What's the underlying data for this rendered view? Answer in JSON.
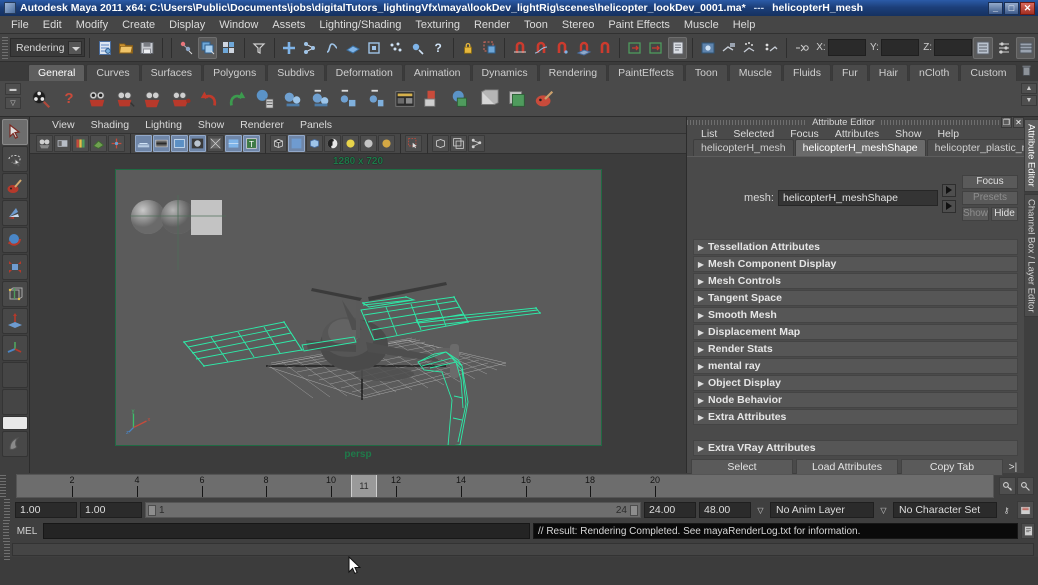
{
  "window": {
    "title": "Autodesk Maya 2011 x64: C:\\Users\\Public\\Documents\\jobs\\digitalTutors_lightingVfx\\maya\\lookDev_lightRig\\scenes\\helicopter_lookDev_0001.ma*",
    "separator": "---",
    "selected_object": "helicopterH_mesh",
    "minimize": "_",
    "restore": "□",
    "close": "✕"
  },
  "menubar": {
    "items": [
      "File",
      "Edit",
      "Modify",
      "Create",
      "Display",
      "Window",
      "Assets",
      "Lighting/Shading",
      "Texturing",
      "Render",
      "Toon",
      "Stereo",
      "Paint Effects",
      "Muscle",
      "Help"
    ]
  },
  "statusline": {
    "mode": "Rendering",
    "icons": [
      "new-scene-icon",
      "open-scene-icon",
      "save-scene-icon",
      "select-by-hierarchy-icon",
      "select-by-object-icon",
      "select-by-component-icon",
      "selection-mask-icon",
      "select-all-icon",
      "select-hierarchy-icon",
      "select-curve-icon",
      "select-surface-icon",
      "select-deformation-icon",
      "select-dynamic-icon",
      "select-rendering-icon",
      "select-other-icon",
      "lock-icon",
      "highlight-selection-icon",
      "snap-grid-icon",
      "snap-curve-icon",
      "snap-point-icon",
      "snap-view-plane-icon",
      "snap-live-icon",
      "construction-history-in-icon",
      "construction-history-out-icon",
      "render-settings-icon",
      "render-current-frame-icon",
      "ipr-render-icon",
      "render-sequence-icon",
      "render-view-icon",
      "input-output-icon"
    ],
    "coord_labels": [
      "X:",
      "Y:",
      "Z:"
    ],
    "coord_values": [
      "",
      "",
      ""
    ],
    "right_icons": [
      "show-attribute-editor-icon",
      "show-tool-settings-icon",
      "show-channel-box-icon"
    ]
  },
  "shelf": {
    "tabs": [
      "General",
      "Curves",
      "Surfaces",
      "Polygons",
      "Subdivs",
      "Deformation",
      "Animation",
      "Dynamics",
      "Rendering",
      "PaintEffects",
      "Toon",
      "Muscle",
      "Fluids",
      "Fur",
      "Hair",
      "nCloth",
      "Custom"
    ],
    "active_tab": "General",
    "buttons": [
      "render-view-icon",
      "render-settings-help-icon",
      "camera-icon",
      "camera-aim-icon",
      "camera-aim-up-icon",
      "stereo-camera-icon",
      "undo-icon",
      "redo-icon",
      "delete-by-type-icon",
      "point-light-icon",
      "directional-light-icon",
      "spot-light-icon",
      "ambient-light-icon",
      "hypershade-icon",
      "lambert-material-icon",
      "blinn-material-icon",
      "phong-material-icon",
      "anisotropic-material-icon",
      "paint-texture-icon"
    ],
    "trash_icon": "trash-icon"
  },
  "toolbox": {
    "tools": [
      {
        "name": "select-tool",
        "selected": true
      },
      {
        "name": "lasso-select-tool",
        "selected": false
      },
      {
        "name": "paint-select-tool",
        "selected": false
      },
      {
        "name": "move-tool",
        "selected": false
      },
      {
        "name": "rotate-tool",
        "selected": false
      },
      {
        "name": "scale-tool",
        "selected": false
      },
      {
        "name": "universal-manipulator-tool",
        "selected": false
      },
      {
        "name": "soft-modification-tool",
        "selected": false
      },
      {
        "name": "show-manipulator-tool",
        "selected": false
      },
      {
        "name": "last-tool-used",
        "selected": false
      }
    ],
    "layout_icon": "quick-layout-icon"
  },
  "viewport": {
    "menu": [
      "View",
      "Shading",
      "Lighting",
      "Show",
      "Renderer",
      "Panels"
    ],
    "toolbar_icons": [
      "select-camera-icon",
      "camera-attributes-icon",
      "bookmark-icon",
      "image-plane-icon",
      "two-d-pan-zoom-icon",
      "grid-toggle-icon",
      "film-gate-icon",
      "resolution-gate-icon",
      "gate-mask-icon",
      "xray-icon",
      "texture-icon",
      "headsup-icon",
      "wireframe-shading-icon",
      "smooth-shading-icon",
      "smooth-shade-all-icon",
      "hardware-texturing-icon",
      "use-default-light-icon",
      "use-all-lights-icon",
      "shadows-icon",
      "isolate-select-icon",
      "xray-joints-icon",
      "xray-active-icon",
      "ipr-update-icon"
    ],
    "resolution_label": "1280 x 720",
    "camera_label": "persp",
    "axis_labels": [
      "y",
      "x",
      "z"
    ]
  },
  "attribute_editor": {
    "panel_title": "Attribute Editor",
    "restore_icon": "❐",
    "close_icon": "✕",
    "menu": [
      "List",
      "Selected",
      "Focus",
      "Attributes",
      "Show",
      "Help"
    ],
    "tabs": [
      "helicopterH_mesh",
      "helicopterH_meshShape",
      "helicopter_plastic_material"
    ],
    "active_tab": "helicopterH_meshShape",
    "node_label": "mesh:",
    "node_value": "helicopterH_meshShape",
    "buttons": {
      "focus": "Focus",
      "presets": "Presets",
      "show": "Show",
      "hide": "Hide"
    },
    "sections": [
      "Tessellation Attributes",
      "Mesh Component Display",
      "Mesh Controls",
      "Tangent Space",
      "Smooth Mesh",
      "Displacement Map",
      "Render Stats",
      "mental ray",
      "Object Display",
      "Node Behavior",
      "Extra Attributes"
    ],
    "extra_section": "Extra VRay Attributes",
    "footer": {
      "select": "Select",
      "load_attributes": "Load Attributes",
      "copy_tab": "Copy Tab",
      "expand_icon": ">|"
    }
  },
  "right_dock": {
    "tabs": [
      "Attribute Editor",
      "Channel Box / Layer Editor"
    ],
    "active": "Attribute Editor"
  },
  "timeline": {
    "ticks": [
      2,
      4,
      6,
      8,
      10,
      12,
      14,
      16,
      18,
      20
    ],
    "current_frame": "11",
    "range_start": "1",
    "range_end": "24",
    "start_field": "1.00",
    "end_field": "1.00",
    "playback_start": "24.00",
    "playback_end": "48.00",
    "anim_layer": "No Anim Layer",
    "character_set": "No Character Set",
    "key_icon": "key-icon",
    "auto-key_icon": "auto-key-icon",
    "anim_pref_icon": "animation-preferences-icon",
    "playback_icons": [
      "go-to-start-icon",
      "step-back-icon",
      "play-backwards-icon",
      "play-forwards-icon",
      "step-forward-icon",
      "go-to-end-icon"
    ]
  },
  "command_line": {
    "label": "MEL",
    "input_value": "",
    "result_text": "// Result: Rendering Completed. See mayaRenderLog.txt for information.",
    "script_editor_icon": "script-editor-icon"
  },
  "colors": {
    "title_gradient_start": "#2b5ba8",
    "title_gradient_end": "#15315f",
    "panel_bg": "#4a4a4a",
    "viewport_bg": "#5b5b5b",
    "wireframe_green": "#2eeaa8",
    "hud_green": "#1f7a4a",
    "accent_blue": "#6f86a8"
  }
}
